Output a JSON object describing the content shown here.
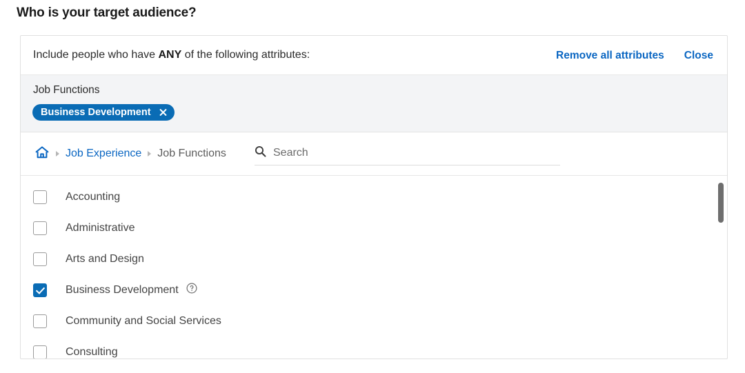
{
  "page": {
    "title": "Who is your target audience?"
  },
  "card": {
    "header": {
      "include_prefix": "Include people who have ",
      "include_strong": "ANY",
      "include_suffix": " of the following attributes:",
      "remove_all_label": "Remove all attributes",
      "close_label": "Close"
    },
    "selected": {
      "group_label": "Job Functions",
      "chips": [
        {
          "label": "Business Development",
          "remove_icon": "close-icon"
        }
      ]
    },
    "nav": {
      "home_icon": "home-icon",
      "breadcrumb": [
        {
          "label": "Job Experience",
          "is_link": true
        },
        {
          "label": "Job Functions",
          "is_link": false
        }
      ],
      "search": {
        "icon": "search-icon",
        "placeholder": "Search",
        "value": ""
      }
    },
    "list": {
      "items": [
        {
          "label": "Accounting",
          "checked": false,
          "help": false
        },
        {
          "label": "Administrative",
          "checked": false,
          "help": false
        },
        {
          "label": "Arts and Design",
          "checked": false,
          "help": false
        },
        {
          "label": "Business Development",
          "checked": true,
          "help": true,
          "help_icon": "question-circle-icon"
        },
        {
          "label": "Community and Social Services",
          "checked": false,
          "help": false
        },
        {
          "label": "Consulting",
          "checked": false,
          "help": false
        }
      ],
      "scrollbar": {
        "name": "vertical-scrollbar"
      }
    }
  },
  "colors": {
    "link_blue": "#0a66c2",
    "chip_blue": "#0a6cb5",
    "band_gray": "#f3f4f6",
    "border": "#e0e0e0"
  }
}
